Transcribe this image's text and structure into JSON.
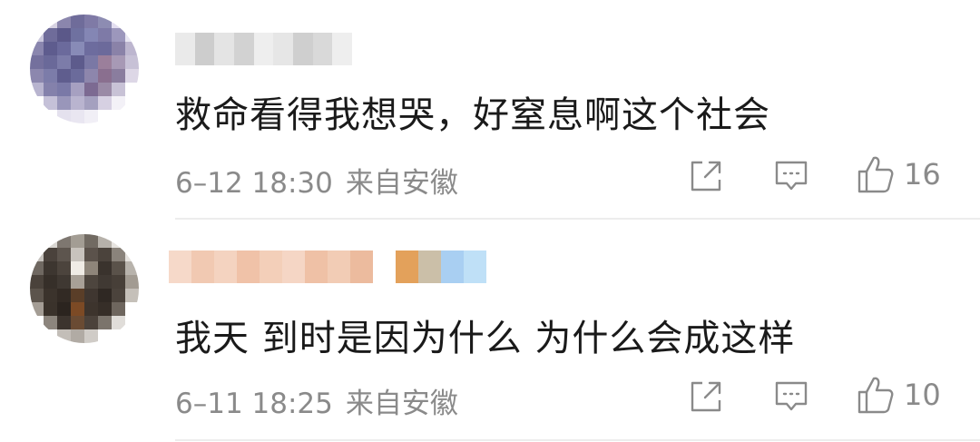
{
  "comments": [
    {
      "text": "救命看得我想哭，好窒息啊这个社会",
      "date": "6–12 18:30",
      "location": "来自安徽",
      "likes": "16",
      "username_blur_colors": [
        "#eaeaea",
        "#cdcdcd",
        "#e4e4e4",
        "#d2d2d2",
        "#eeeeee",
        "#e6e6e6",
        "#cfcfcf",
        "#d9d9d9",
        "#eeeeee"
      ],
      "avatar_blur_colors": [
        "#ffffff",
        "#d7d2e2",
        "#8b86ad",
        "#6f6c9a",
        "#7f7aa6",
        "#8d8cb2",
        "#e3def0",
        "#ffffff",
        "#c9c6dc",
        "#6f6c9a",
        "#5b5889",
        "#6f71a0",
        "#8486b4",
        "#7e7aa7",
        "#9c97bc",
        "#e8e6f2",
        "#8a86ae",
        "#5e5c8e",
        "#6b6a9c",
        "#888bb7",
        "#6d6c9e",
        "#6c6a9b",
        "#8a82a8",
        "#bdb6cf",
        "#74709d",
        "#6a6999",
        "#7c7ca9",
        "#5d5b8c",
        "#7a78a5",
        "#9b7f9b",
        "#a799b5",
        "#c7c1d6",
        "#8c87ae",
        "#7c7ca9",
        "#5f5d8e",
        "#6b6b9b",
        "#8d86ac",
        "#8a6f8f",
        "#8a7d9e",
        "#ddd7e6",
        "#b8b4cf",
        "#8481ab",
        "#7a79a7",
        "#a6a0c1",
        "#7c6a92",
        "#9a8aa6",
        "#c8c2d6",
        "#ffffff",
        "#ffffff",
        "#c5c1d8",
        "#9996ba",
        "#b9b4cf",
        "#a4a0bf",
        "#d6d0e2",
        "#f3f1f7",
        "#ffffff",
        "#ffffff",
        "#ffffff",
        "#e4e1ee",
        "#e9e6f1",
        "#f1eff6",
        "#ffffff",
        "#ffffff",
        "#ffffff"
      ]
    },
    {
      "text": "我天 到时是因为什么 为什么会成这样",
      "date": "6–11 18:25",
      "location": "来自安徽",
      "likes": "10",
      "username_blur_colors": [
        "#f6d9c9",
        "#f1c9b2",
        "#f4d3c0",
        "#f0c2a8",
        "#f3cfb9",
        "#f5d6c5",
        "#efc1a6",
        "#f2ccb5",
        "#ecbb9e",
        "#ffffff",
        "#e3a15b",
        "#cbbfa8",
        "#a9cff2",
        "#bfe0f7"
      ],
      "avatar_blur_colors": [
        "#ffffff",
        "#d9d6d2",
        "#7e7770",
        "#a39d94",
        "#716a62",
        "#b6b1aa",
        "#e7e4e0",
        "#ffffff",
        "#c4c0bb",
        "#4a423c",
        "#5d554e",
        "#c8c3bd",
        "#5b524b",
        "#4b433c",
        "#8a837b",
        "#e5e2de",
        "#6f6861",
        "#3d3630",
        "#4c443d",
        "#f0ece6",
        "#8e857a",
        "#3a332d",
        "#5a524a",
        "#b8b3ac",
        "#4a423b",
        "#362f29",
        "#3f3832",
        "#a8a097",
        "#4d453e",
        "#403933",
        "#473f38",
        "#a29b92",
        "#5c544c",
        "#3b332c",
        "#322a24",
        "#5a3e28",
        "#3f3630",
        "#2f2823",
        "#4b433c",
        "#c5c0b9",
        "#a49d95",
        "#3a322b",
        "#2b241f",
        "#7c4a25",
        "#3d342d",
        "#362e28",
        "#6e665e",
        "#ffffff",
        "#ffffff",
        "#8c857d",
        "#3c342e",
        "#6a4b33",
        "#4b423b",
        "#7b746c",
        "#e0ddd9",
        "#ffffff",
        "#ffffff",
        "#ffffff",
        "#c3beb8",
        "#b1aba4",
        "#d0ccc7",
        "#ffffff",
        "#ffffff",
        "#ffffff"
      ]
    }
  ]
}
